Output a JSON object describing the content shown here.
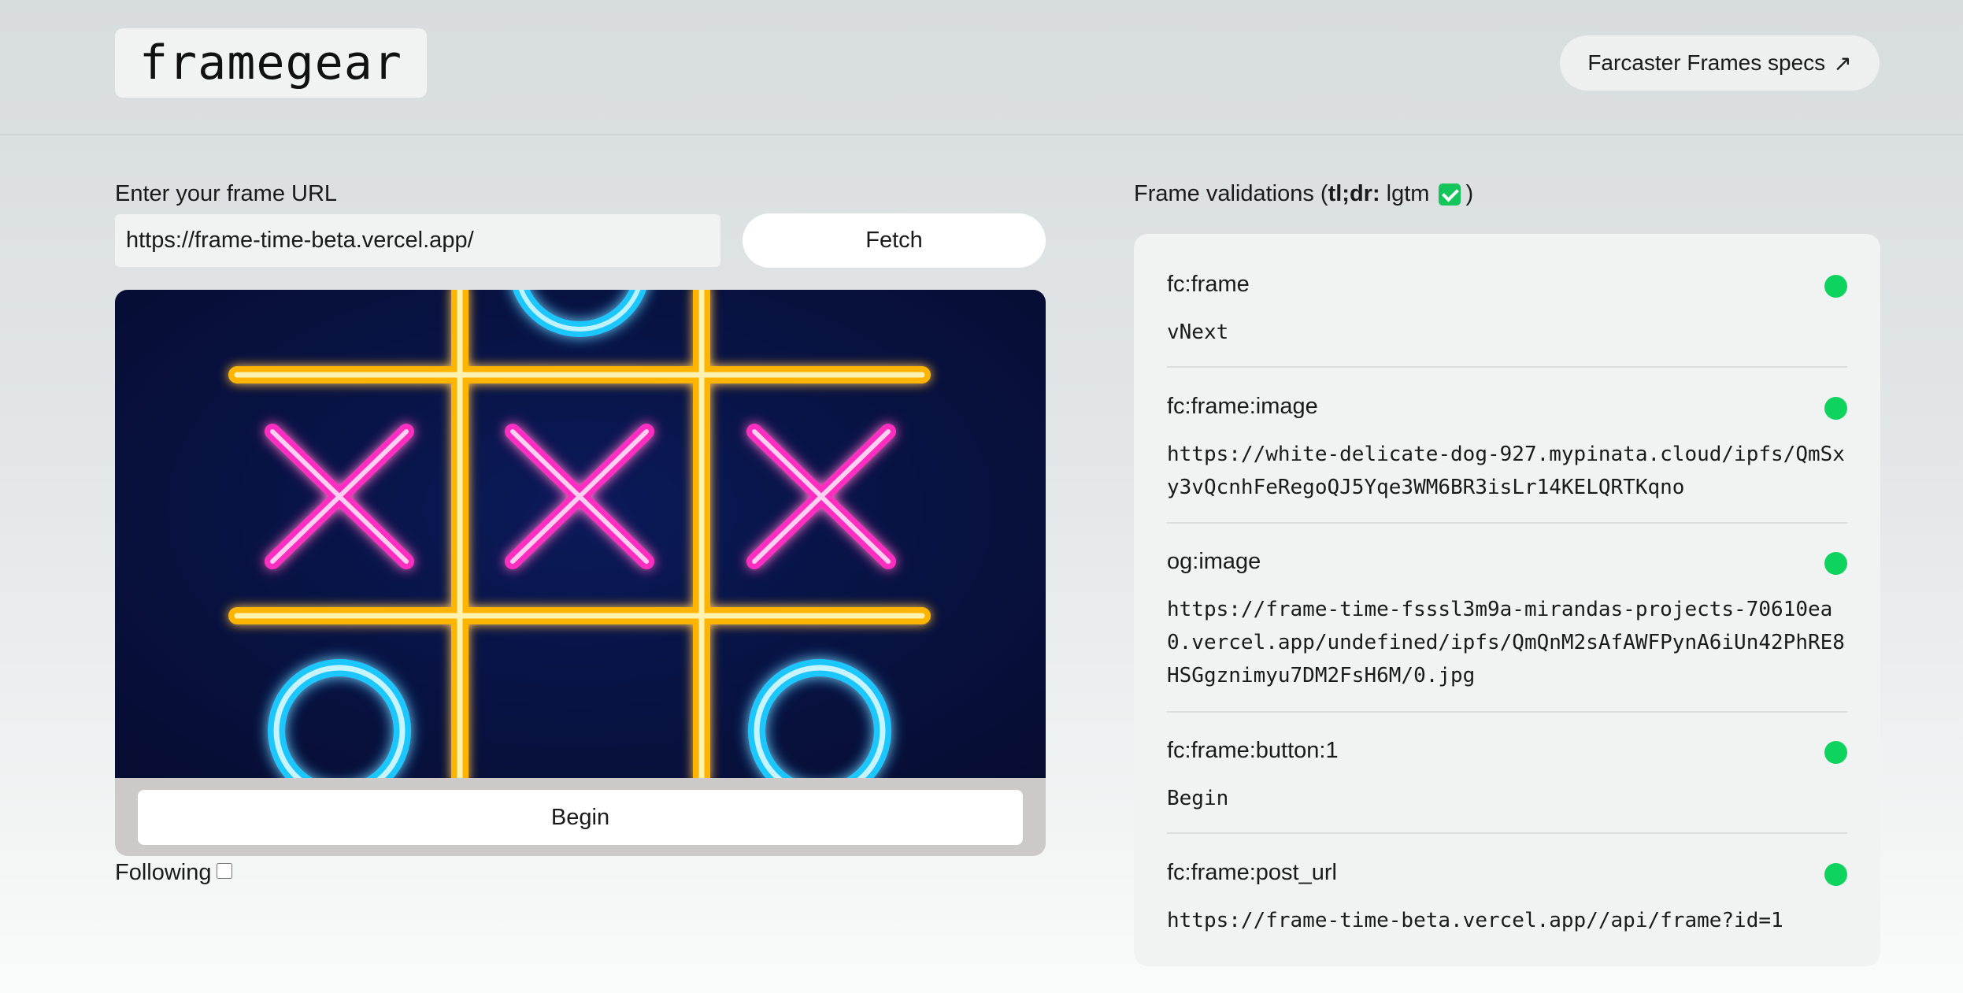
{
  "header": {
    "logo": "framegear",
    "specs_link": "Farcaster Frames specs",
    "specs_arrow": "↗"
  },
  "url_form": {
    "label": "Enter your frame URL",
    "value": "https://frame-time-beta.vercel.app/",
    "fetch_label": "Fetch"
  },
  "frame": {
    "image_description_icon": "tic-tac-toe-board-image",
    "button_label": "Begin"
  },
  "following": {
    "label": "Following",
    "checked": false
  },
  "validations": {
    "heading_prefix": "Frame validations (",
    "heading_bold": "tl;dr:",
    "heading_text": " lgtm",
    "heading_suffix": ")",
    "status_color": "#0fd35f",
    "items": [
      {
        "name": "fc:frame",
        "value": "vNext"
      },
      {
        "name": "fc:frame:image",
        "value": "https://white-delicate-dog-927.mypinata.cloud/ipfs/QmSxy3vQcnhFeRegoQJ5Yqe3WM6BR3isLr14KELQRTKqno"
      },
      {
        "name": "og:image",
        "value": "https://frame-time-fsssl3m9a-mirandas-projects-70610ea0.vercel.app/undefined/ipfs/QmQnM2sAfAWFPynA6iUn42PhRE8HSGgznimyu7DM2FsH6M/0.jpg"
      },
      {
        "name": "fc:frame:button:1",
        "value": "Begin"
      },
      {
        "name": "fc:frame:post_url",
        "value": "https://frame-time-beta.vercel.app//api/frame?id=1"
      }
    ]
  }
}
